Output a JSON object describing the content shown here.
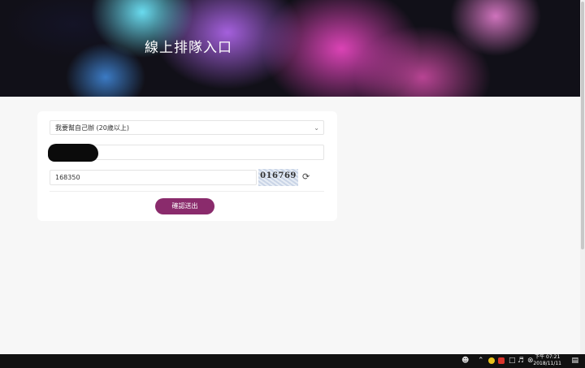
{
  "header": {
    "title": "線上排隊入口"
  },
  "form": {
    "select_value": "我要幫自己辦 (20歲以上)",
    "captcha_input_value": "168350",
    "captcha_image_text": "016769",
    "submit_label": "確認送出"
  },
  "taskbar": {
    "clock_time": "下午 07:21",
    "clock_date": "2018/11/11"
  },
  "colors": {
    "accent": "#8a2b6c"
  }
}
